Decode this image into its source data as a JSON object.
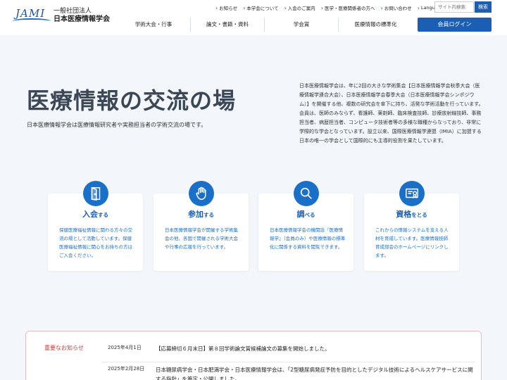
{
  "header": {
    "logo_mark": "JAMI",
    "org_line1": "一般社団法人",
    "org_line2": "日本医療情報学会",
    "util_links": [
      "お知らせ",
      "本学会について",
      "入会のご案内",
      "医学・医療関係者の方へ",
      "お問い合わせ",
      "Language"
    ],
    "search_placeholder": "サイト内検索",
    "search_button": "検索",
    "main_nav": [
      "学術大会・行事",
      "論文・書籍・資料",
      "学会賞",
      "医療情報の標準化"
    ],
    "login_button": "会員ログイン"
  },
  "hero": {
    "title": "医療情報の交流の場",
    "subtitle": "日本医療情報学会は医療情報研究者や実務担当者の学術交流の場です。",
    "description": "日本医療情報学会は、年に2回の大きな学術集会【日本医療情報学会秋季大会（医療情報学連合大会）、日本医療情報学会春季大会（日本医療情報学会シンポジウム）】を開催する他、複数の研究会を傘下に持ち、活発な学術活動を行っています。会員は、医師のみならず、看護師、薬剤師、臨床検査技師、診療放射線技師、事務担当者、病歴担当者、コンピュータ技術者等の多様な職種からなっており、非常に学際的な学会となっています。設立以来、国際医療情報学連盟（IMIA）に加盟する日本の唯一の学会として国際的にも主導的役割を果たしています。"
  },
  "cards": [
    {
      "icon": "door-icon",
      "title_main": "入会",
      "title_suffix": "する",
      "body": "保健医療福祉情報に関わる方々の交流の場として活動しています。保健医療福祉情報に関心をお持ちの方はご入会ください。"
    },
    {
      "icon": "raised-hand-icon",
      "title_main": "参加",
      "title_suffix": "する",
      "body": "日本医療情報学会が開催する学術集会の他、各国で開催される学術大会や行事の広報を行っています。"
    },
    {
      "icon": "magnifier-icon",
      "title_main": "調",
      "title_suffix": "べる",
      "body": "日本医療情報学会の機関誌『医療情報学』（会員のみ）や医療情報の標準化に関係する資料を閲覧できます。"
    },
    {
      "icon": "certificate-icon",
      "title_main": "資格",
      "title_suffix": "をとる",
      "body": "これからの情報システムを支える人材を育成しています。医療情報技師育成部会のホームページにリンクします。"
    }
  ],
  "news": {
    "label": "重要なお知らせ",
    "items": [
      {
        "date": "2025年4月1日",
        "text": "【応募締切６月末日】第８回学術論文賞候補論文の募集を開始しました。"
      },
      {
        "date": "2025年2月28日",
        "text": "日本糖尿病学会・日本肥満学会・日本医療情報学会は、「2型糖尿病発症予防を目的としたデジタル技術によるヘルスケアサービスに関する指針」を策定・公開しました。"
      }
    ]
  },
  "colors": {
    "primary": "#1a5fb4",
    "accent_red": "#d23b3b",
    "bg": "#f3f7fb"
  }
}
